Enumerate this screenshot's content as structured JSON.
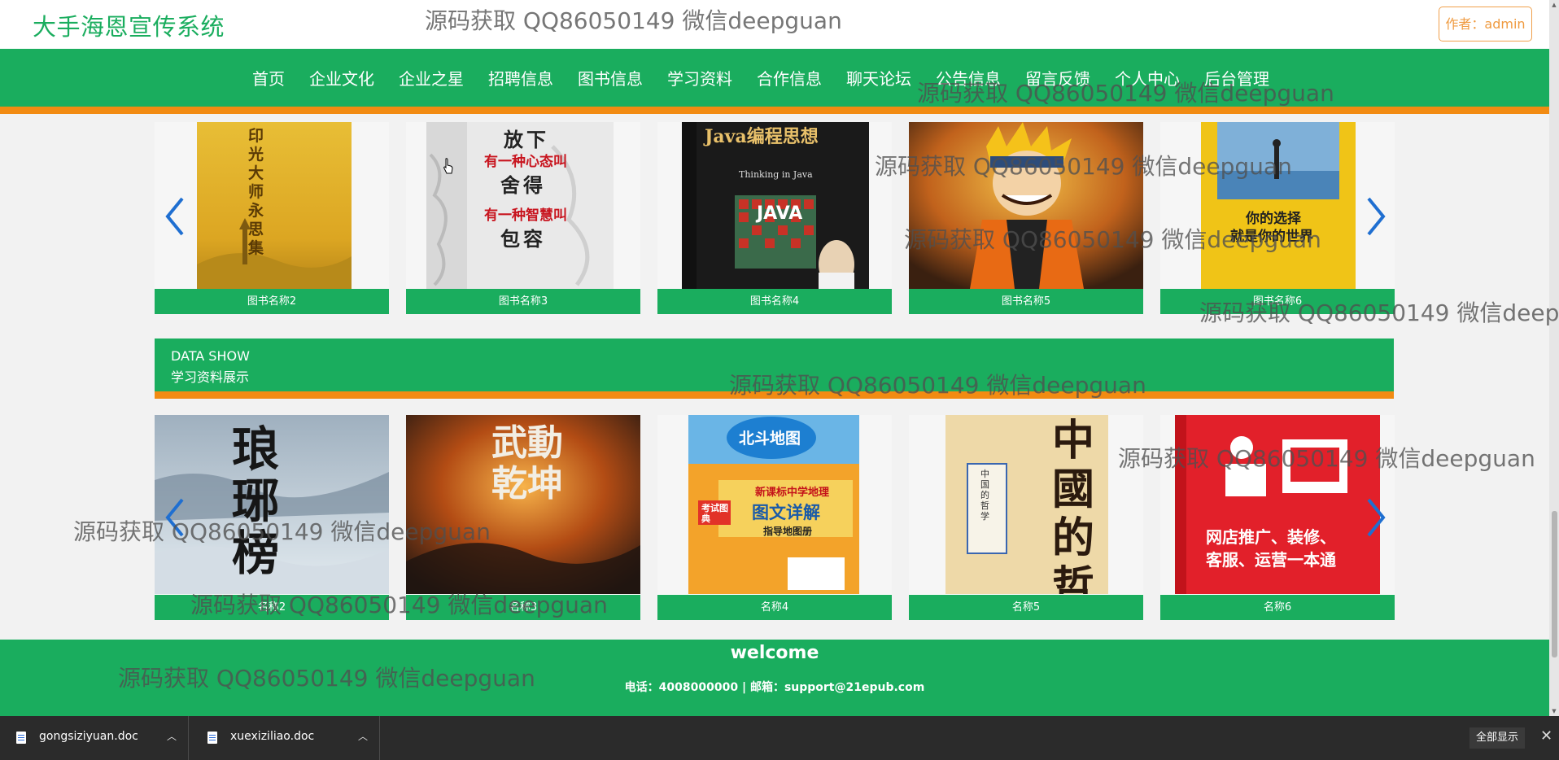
{
  "header": {
    "title": "大手海恩宣传系统",
    "author_button": "作者：admin"
  },
  "nav": {
    "items": [
      "首页",
      "企业文化",
      "企业之星",
      "招聘信息",
      "图书信息",
      "学习资料",
      "合作信息",
      "聊天论坛",
      "公告信息",
      "留言反馈",
      "个人中心",
      "后台管理"
    ]
  },
  "books": {
    "captions": [
      "图书名称2",
      "图书名称3",
      "图书名称4",
      "图书名称5",
      "图书名称6"
    ],
    "cover_texts": {
      "book2": "印光大师永思集",
      "book3_line1": "放下",
      "book3_line2": "有一种心态叫",
      "book3_line3": "舍得",
      "book3_line4": "有一种智慧叫",
      "book3_line5": "包容",
      "book4_title": "Java编程思想",
      "book4_sub": "Thinking in Java",
      "book4_java": "JAVA",
      "book6_line1": "你的选择",
      "book6_line2": "就是你的世界"
    }
  },
  "section": {
    "en": "DATA SHOW",
    "cn": "学习资料展示"
  },
  "materials": {
    "captions": [
      "名称2",
      "名称3",
      "名称4",
      "名称5",
      "名称6"
    ],
    "cover_texts": {
      "m2": "琅琊榜",
      "m3": "武動乾坤",
      "m4_brand": "北斗地图",
      "m4_tag": "考试图典",
      "m4_title1": "新课标中学地理",
      "m4_title2": "图文详解",
      "m4_title3": "指导地图册",
      "m5_big": "中國的哲學",
      "m5_small": "中国的哲学",
      "m6_line1": "网店推广、装修、",
      "m6_line2": "客服、运营一本通"
    }
  },
  "footer": {
    "welcome": "welcome",
    "contact": "电话：4008000000 | 邮箱：support@21epub.com"
  },
  "downloads": {
    "items": [
      "gongsiziyuan.doc",
      "xuexiziliao.doc"
    ],
    "show_all": "全部显示"
  },
  "watermark": {
    "text": "源码获取 QQ86050149 微信deepguan"
  },
  "colors": {
    "primary_green": "#1aad5e",
    "accent_orange": "#f28b12",
    "author_border": "#f0a04b"
  }
}
